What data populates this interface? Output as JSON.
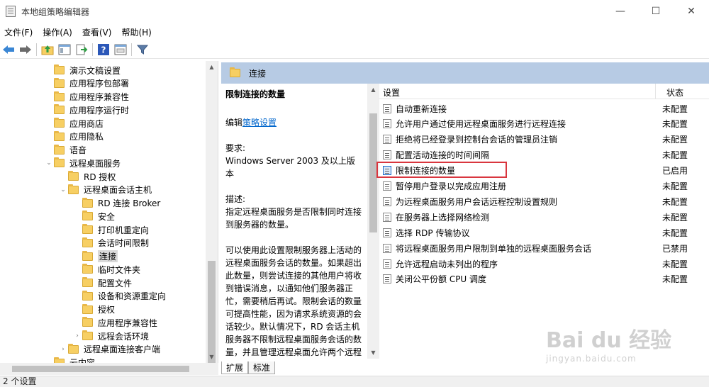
{
  "window": {
    "title": "本地组策略编辑器",
    "minimize": "—",
    "maximize": "☐",
    "close": "✕"
  },
  "menu": [
    "文件(F)",
    "操作(A)",
    "查看(V)",
    "帮助(H)"
  ],
  "toolbar": [
    "back-icon",
    "forward-icon",
    "up-folder-icon",
    "show-hide-tree-icon",
    "export-icon",
    "help-icon",
    "properties-icon",
    "filter-icon"
  ],
  "tree": [
    {
      "label": "演示文稿设置",
      "level": 3
    },
    {
      "label": "应用程序包部署",
      "level": 3
    },
    {
      "label": "应用程序兼容性",
      "level": 3
    },
    {
      "label": "应用程序运行时",
      "level": 3
    },
    {
      "label": "应用商店",
      "level": 3
    },
    {
      "label": "应用隐私",
      "level": 3
    },
    {
      "label": "语音",
      "level": 3
    },
    {
      "label": "远程桌面服务",
      "level": 3,
      "expander": "open"
    },
    {
      "label": "RD 授权",
      "level": 4
    },
    {
      "label": "远程桌面会话主机",
      "level": 4,
      "expander": "open"
    },
    {
      "label": "RD 连接 Broker",
      "level": 5
    },
    {
      "label": "安全",
      "level": 5
    },
    {
      "label": "打印机重定向",
      "level": 5
    },
    {
      "label": "会话时间限制",
      "level": 5
    },
    {
      "label": "连接",
      "level": 5,
      "selected": true
    },
    {
      "label": "临时文件夹",
      "level": 5
    },
    {
      "label": "配置文件",
      "level": 5
    },
    {
      "label": "设备和资源重定向",
      "level": 5
    },
    {
      "label": "授权",
      "level": 5
    },
    {
      "label": "应用程序兼容性",
      "level": 5
    },
    {
      "label": "远程会话环境",
      "level": 5,
      "expander": "closed"
    },
    {
      "label": "远程桌面连接客户端",
      "level": 4,
      "expander": "closed"
    },
    {
      "label": "云内容",
      "level": 3
    }
  ],
  "right": {
    "header": "连接",
    "desc": {
      "title": "限制连接的数量",
      "edit_prefix": "编辑",
      "edit_link": "策略设置",
      "req_label": "要求:",
      "req_value": "Windows Server 2003 及以上版本",
      "desc_label": "描述:",
      "desc_1": "指定远程桌面服务是否限制同时连接到服务器的数量。",
      "desc_2": "可以使用此设置限制服务器上活动的远程桌面服务会话的数量。如果超出此数量，则尝试连接的其他用户将收到错误消息，以通知他们服务器正忙，需要稍后再试。限制会话的数量可提高性能，因为请求系统资源的会话较少。默认情况下，RD 会话主机服务器不限制远程桌面服务会话的数量，并且管理远程桌面允许两个远程桌面服务会话。"
    },
    "columns": {
      "setting": "设置",
      "state": "状态"
    },
    "rows": [
      {
        "name": "自动重新连接",
        "state": "未配置"
      },
      {
        "name": "允许用户通过使用远程桌面服务进行远程连接",
        "state": "未配置"
      },
      {
        "name": "拒绝将已经登录到控制台会话的管理员注销",
        "state": "未配置"
      },
      {
        "name": "配置活动连接的时间间隔",
        "state": "未配置"
      },
      {
        "name": "限制连接的数量",
        "state": "已启用",
        "highlight": true
      },
      {
        "name": "暂停用户登录以完成应用注册",
        "state": "未配置"
      },
      {
        "name": "为远程桌面服务用户会话远程控制设置规则",
        "state": "未配置"
      },
      {
        "name": "在服务器上选择网络检测",
        "state": "未配置"
      },
      {
        "name": "选择 RDP 传输协议",
        "state": "未配置"
      },
      {
        "name": "将远程桌面服务用户限制到单独的远程桌面服务会话",
        "state": "已禁用"
      },
      {
        "name": "允许远程启动未列出的程序",
        "state": "未配置"
      },
      {
        "name": "关闭公平份额 CPU 调度",
        "state": "未配置"
      }
    ]
  },
  "tabs": [
    "扩展",
    "标准"
  ],
  "status": "2 个设置",
  "watermark": {
    "main": "Bai du 经验",
    "sub": "jingyan.baidu.com"
  },
  "colors": {
    "header_bg": "#b7cbe4",
    "link": "#0066cc",
    "highlight_box": "#d9363e",
    "folder": "#f7cf63"
  }
}
